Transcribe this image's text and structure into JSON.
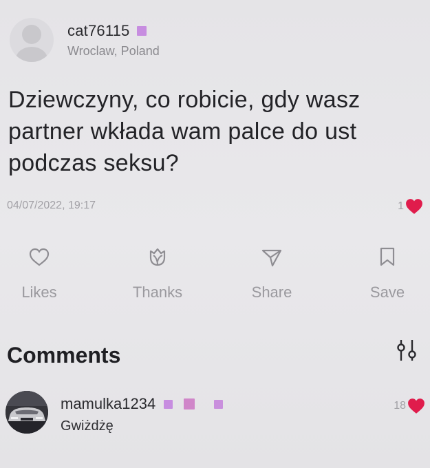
{
  "post": {
    "author": {
      "username": "cat76115",
      "badge_icon": "rank-badge-icon",
      "location": "Wroclaw, Poland"
    },
    "text_lines": [
      "Dziewczyny, co robicie, gdy wasz",
      "partner wkłada wam palce do ust",
      "podczas seksu?"
    ],
    "date": "04/07/2022, 19:17",
    "likes_count": "1"
  },
  "actions": {
    "likes_label": "Likes",
    "thanks_label": "Thanks",
    "share_label": "Share",
    "save_label": "Save"
  },
  "comments": {
    "title": "Comments",
    "items": [
      {
        "username": "mamulka1234",
        "text": "Gwiżdżę",
        "likes": "18"
      }
    ]
  },
  "colors": {
    "background": "#e6e5e8",
    "heart": "#e01c4c",
    "badge": "#c78de0",
    "muted_text": "#9a999e"
  }
}
